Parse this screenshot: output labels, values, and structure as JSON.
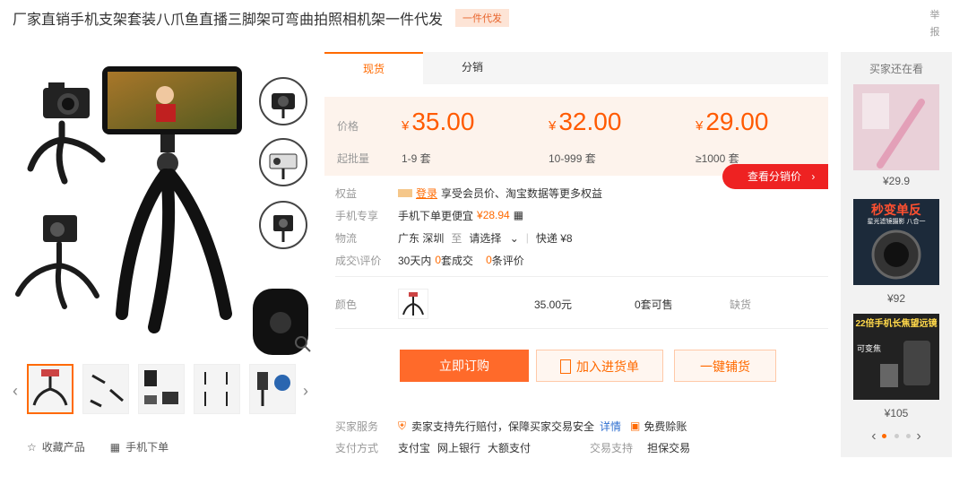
{
  "title": "厂家直销手机支架套装八爪鱼直播三脚架可弯曲拍照相机架一件代发",
  "title_tag": "一件代发",
  "report_label": "举报",
  "tabs": [
    {
      "label": "现货",
      "active": true
    },
    {
      "label": "分销",
      "active": false
    }
  ],
  "price_panel": {
    "price_label": "价格",
    "moq_label": "起批量",
    "currency": "¥",
    "tiers": [
      {
        "price": "35.00",
        "qty": "1-9 套"
      },
      {
        "price": "32.00",
        "qty": "10-999 套"
      },
      {
        "price": "29.00",
        "qty": "≥1000 套"
      }
    ],
    "distribution_button": "查看分销价"
  },
  "info": {
    "rights_label": "权益",
    "rights_login": "登录",
    "rights_text": "享受会员价、淘宝数据等更多权益",
    "mobile_label": "手机专享",
    "mobile_text": "手机下单更便宜",
    "mobile_price": "¥28.94",
    "logistics_label": "物流",
    "logistics_from": "广东 深圳",
    "logistics_to": "至",
    "logistics_select": "请选择",
    "logistics_express": "快递 ¥8",
    "deal_label": "成交\\评价",
    "deal_prefix": "30天内",
    "deal_count": "0",
    "deal_suffix": "套成交",
    "review_count": "0",
    "review_suffix": "条评价"
  },
  "color_row": {
    "label": "颜色",
    "price": "35.00元",
    "stock": "0套可售",
    "status": "缺货"
  },
  "buttons": {
    "order": "立即订购",
    "add_cart": "加入进货单",
    "one_click": "一键铺货"
  },
  "service": {
    "buyer_label": "买家服务",
    "buyer_text": "卖家支持先行赔付，保障买家交易安全",
    "buyer_detail": "详情",
    "buyer_extra": "免费赊账",
    "pay_label": "支付方式",
    "pay_methods": [
      "支付宝",
      "网上银行",
      "大额支付"
    ],
    "trade_label": "交易支持",
    "trade_value": "担保交易"
  },
  "bottom_actions": {
    "favorite": "收藏产品",
    "mobile_order": "手机下单"
  },
  "sidebar": {
    "title": "买家还在看",
    "items": [
      {
        "price": "¥29.9"
      },
      {
        "price": "¥92",
        "banner": "秒变单反",
        "sub": "星光滤镜摄影 八合一"
      },
      {
        "price": "¥105",
        "banner": "22倍手机长焦望远镜",
        "sub": "可变焦"
      }
    ]
  },
  "colors": {
    "accent": "#ff6a00",
    "red": "#e22222"
  }
}
